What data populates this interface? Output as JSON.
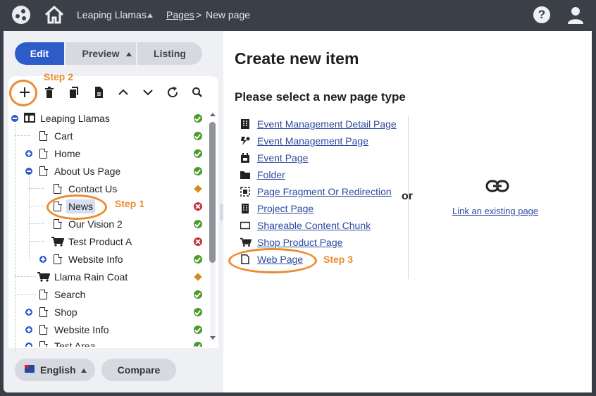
{
  "topbar": {
    "site_name": "Leaping Llamas",
    "breadcrumb_pages": "Pages",
    "breadcrumb_separator": ">",
    "breadcrumb_current": "New page",
    "help_label": "?"
  },
  "modes": {
    "edit": "Edit",
    "preview": "Preview",
    "listing": "Listing"
  },
  "toolbar_icons": [
    "add-icon",
    "delete-icon",
    "copy-icon",
    "paste-icon",
    "move-up-icon",
    "move-down-icon",
    "refresh-icon",
    "search-icon"
  ],
  "tree": [
    {
      "label": "Leaping Llamas",
      "status": "ok"
    },
    {
      "label": "Cart",
      "status": "ok"
    },
    {
      "label": "Home",
      "status": "ok"
    },
    {
      "label": "About Us Page",
      "status": "ok"
    },
    {
      "label": "Contact Us",
      "status": "warn"
    },
    {
      "label": "News",
      "status": "error"
    },
    {
      "label": "Our Vision 2",
      "status": "ok"
    },
    {
      "label": "Test Product A",
      "status": "error"
    },
    {
      "label": "Website Info",
      "status": "ok"
    },
    {
      "label": "Llama Rain Coat",
      "status": "warn"
    },
    {
      "label": "Search",
      "status": "ok"
    },
    {
      "label": "Shop",
      "status": "ok"
    },
    {
      "label": "Website Info",
      "status": "ok"
    },
    {
      "label": "Test Area",
      "status": "ok"
    }
  ],
  "footer": {
    "language": "English",
    "compare": "Compare"
  },
  "main": {
    "title": "Create new item",
    "subtitle": "Please select a new page type",
    "page_types": [
      {
        "label": "Event Management Detail Page",
        "icon": "grid-icon"
      },
      {
        "label": "Event Management Page",
        "icon": "event-manage-icon"
      },
      {
        "label": "Event Page",
        "icon": "calendar-icon"
      },
      {
        "label": "Folder",
        "icon": "folder-icon"
      },
      {
        "label": "Page Fragment Or Redirection",
        "icon": "fragment-icon"
      },
      {
        "label": "Project Page",
        "icon": "building-icon"
      },
      {
        "label": "Shareable Content Chunk",
        "icon": "chunk-icon"
      },
      {
        "label": "Shop Product Page",
        "icon": "cart-icon"
      },
      {
        "label": "Web Page",
        "icon": "page-icon"
      }
    ],
    "or_label": "or",
    "link_existing": "Link an existing page"
  },
  "annotations": {
    "step1": "Step 1",
    "step2": "Step 2",
    "step3": "Step 3"
  },
  "colors": {
    "accent": "#2d5cc8",
    "annotation": "#ec8a2e",
    "ok": "#4a9b2c",
    "error": "#c72f3b",
    "warn": "#d9891b"
  }
}
